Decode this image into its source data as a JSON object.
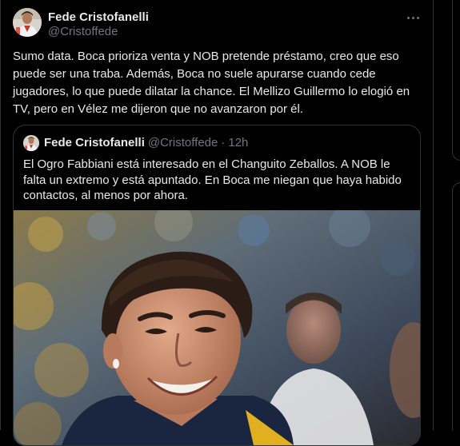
{
  "tweet": {
    "author_name": "Fede Cristofanelli",
    "handle": "@Cristoffede",
    "text": "Sumo data. Boca prioriza venta y NOB pretende préstamo, creo que eso puede ser una traba. Además, Boca no suele apurarse cuando cede jugadores, lo que puede dilatar la chance. El Mellizo Guillermo lo elogió en TV, pero en Vélez me dijeron que no avanzaron por él."
  },
  "quote": {
    "author_name": "Fede Cristofanelli",
    "handle": "@Cristoffede",
    "separator": "·",
    "time": "12h",
    "text": "El Ogro Fabbiani está interesado en el Changuito Zeballos. A NOB le falta un extremo y está apuntado. En Boca me niegan que haya habido contactos, al menos por ahora."
  },
  "colors": {
    "background": "#000000",
    "text_primary": "#e7e9ea",
    "text_secondary": "#71767b",
    "border": "#2f3336"
  },
  "icons": {
    "more": "more-horizontal-icon"
  }
}
